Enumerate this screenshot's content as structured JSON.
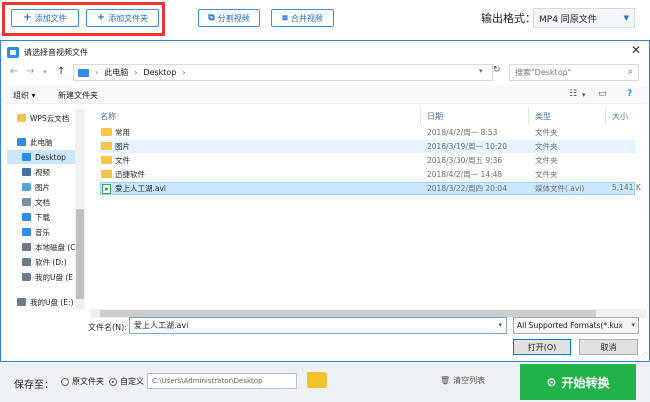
{
  "toolbar": {
    "add_file": "添加文件",
    "add_folder": "添加文件夹",
    "split_video": "分割视频",
    "merge_video": "合并视频",
    "output_format_label": "输出格式：",
    "output_format_value": "MP4  同原文件"
  },
  "bottom": {
    "save_to_label": "保存至：",
    "radio_original": "原文件夹",
    "radio_custom": "自定义",
    "path": "C:\\Users\\Administrator\\Desktop",
    "clear_list": "清空列表",
    "start": "开始转换"
  },
  "dialog": {
    "title": "请选择音视频文件",
    "address_pc": "此电脑",
    "address_folder": "Desktop",
    "search_placeholder": "搜索\"Desktop\"",
    "organize": "组织 ▾",
    "new_folder": "新建文件夹",
    "columns": {
      "name": "名称",
      "date": "日期",
      "type": "类型",
      "size": "大小"
    },
    "nav_items": [
      {
        "label": "WPS云文档",
        "color": "#f4c547"
      },
      {
        "label": "此电脑",
        "color": "#2e8ee6"
      },
      {
        "label": "Desktop",
        "color": "#2e8ee6"
      },
      {
        "label": "视频",
        "color": "#4a6fa5"
      },
      {
        "label": "图片",
        "color": "#5aa0d8"
      },
      {
        "label": "文档",
        "color": "#7a8ea8"
      },
      {
        "label": "下载",
        "color": "#2e8ee6"
      },
      {
        "label": "音乐",
        "color": "#2e8ee6"
      },
      {
        "label": "本地磁盘 (C",
        "color": "#6f7b89"
      },
      {
        "label": "软件 (D:)",
        "color": "#6f7b89"
      },
      {
        "label": "我的U盘 (E",
        "color": "#6f7b89"
      },
      {
        "label": "我的U盘 (E:)",
        "color": "#6f7b89"
      }
    ],
    "files": [
      {
        "name": "常用",
        "date": "2018/4/2/周一 8:53",
        "type": "文件夹",
        "size": "",
        "kind": "folder"
      },
      {
        "name": "图片",
        "date": "2018/3/19/周一 10:20",
        "type": "文件夹",
        "size": "",
        "kind": "folder"
      },
      {
        "name": "文件",
        "date": "2018/3/30/周五 9:36",
        "type": "文件夹",
        "size": "",
        "kind": "folder"
      },
      {
        "name": "迅捷软件",
        "date": "2018/4/2/周一 14:48",
        "type": "文件夹",
        "size": "",
        "kind": "folder"
      },
      {
        "name": "爱上人工湖.avi",
        "date": "2018/3/22/周四 20:04",
        "type": "媒体文件(.avi)",
        "size": "5,141 K",
        "kind": "avi"
      }
    ],
    "filename_label": "文件名(N):",
    "filename_value": "爱上人工湖.avi",
    "filetype_value": "All Supported Formats(*.kux",
    "open_button": "打开(O)",
    "cancel_button": "取消"
  }
}
